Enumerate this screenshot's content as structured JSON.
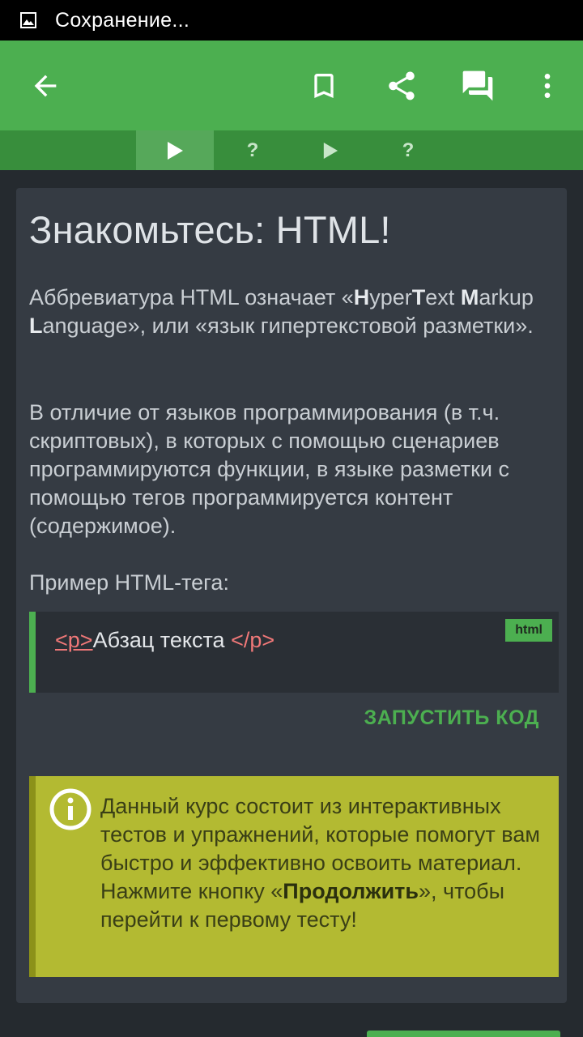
{
  "status_bar": {
    "text": "Сохранение..."
  },
  "app_bar": {
    "back_icon": "arrow-back-icon",
    "actions": [
      "bookmark-icon",
      "share-icon",
      "comments-icon",
      "more-vert-icon"
    ]
  },
  "steps": [
    {
      "type": "play",
      "state": "active"
    },
    {
      "type": "question",
      "label": "?"
    },
    {
      "type": "play",
      "state": "inactive"
    },
    {
      "type": "question",
      "label": "?"
    }
  ],
  "lesson": {
    "title": "Знакомьтесь: HTML!",
    "para1": {
      "p1": "Аббревиатура HTML означает «",
      "H": "H",
      "yper": "yper",
      "T": "T",
      "ext": "ext",
      "M": "M",
      "arkup": "arkup ",
      "L": "L",
      "anguage": "anguage",
      "p2": "», или «язык гипертекстовой разметки»."
    },
    "para2": "В отличие от языков программирования (в т.ч. скриптовых), в которых с помощью сценариев программируются функции, в языке разметки с помощью тегов программируется контент (содержимое).",
    "example_label": "Пример HTML-тега:",
    "code": {
      "open_tag": "<p>",
      "content": "Абзац текста ",
      "close_tag": "</p>",
      "language": "html"
    },
    "run_button": "ЗАПУСТИТЬ КОД",
    "info": {
      "text_before": "Данный курс состоит из интерактивных тестов и упражнений, которые помогут вам быстро и эффективно освоить материал. Нажмите кнопку «",
      "bold": "Продолжить",
      "text_after": "», чтобы перейти к первому тесту!"
    }
  },
  "colors": {
    "accent": "#4caf50",
    "info_bg": "#b3ba32",
    "card_bg": "#353b43"
  }
}
